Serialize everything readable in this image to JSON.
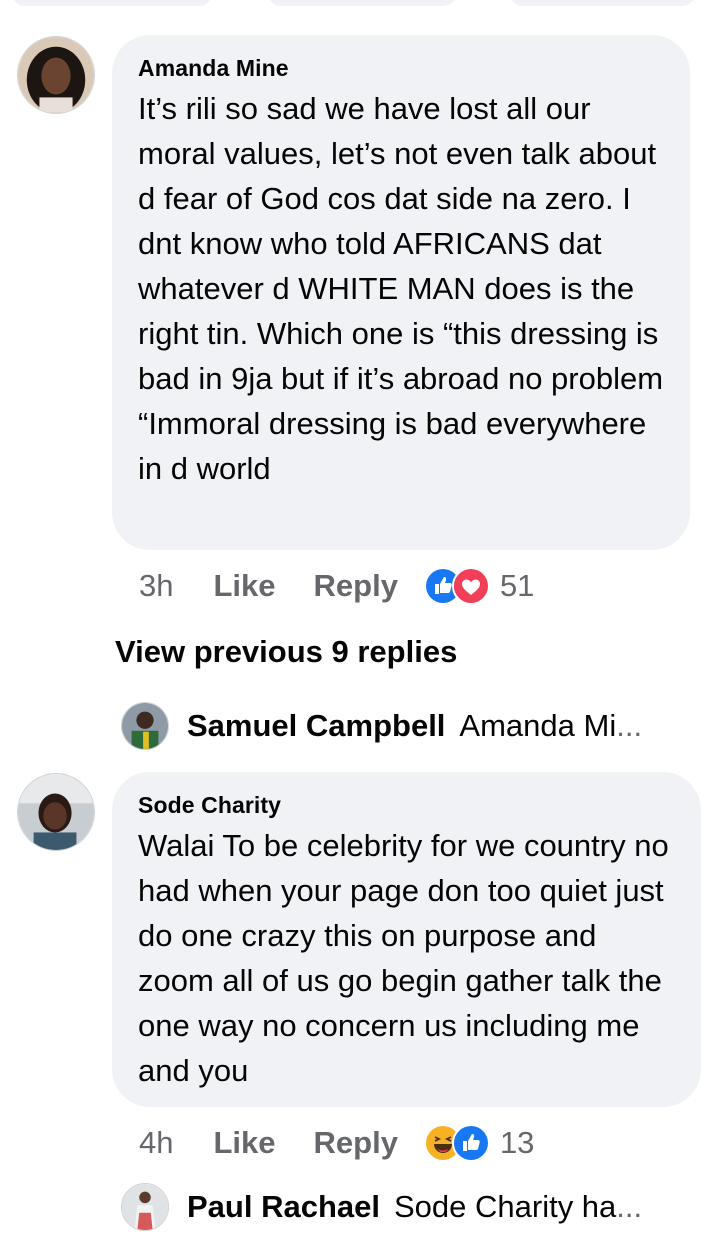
{
  "comments": [
    {
      "author": "Amanda Mine",
      "text": "It’s rili so sad we have lost all our moral values, let’s not even talk about d fear of God cos dat side na zero. I dnt know who told AFRICANS dat whatever d WHITE MAN does is the right tin. Which one is “this dressing is bad in 9ja but if it’s abroad no problem “Immoral dressing is bad everywhere in d world",
      "time": "3h",
      "like_label": "Like",
      "reply_label": "Reply",
      "reactions": [
        "like-icon",
        "love-icon"
      ],
      "reaction_count": "51"
    },
    {
      "author": "Sode Charity",
      "text": "Walai To be celebrity for we country no had when your page don too quiet just do one crazy this on purpose and zoom all of us go begin gather talk the one way no concern us including me and you",
      "time": "4h",
      "like_label": "Like",
      "reply_label": "Reply",
      "reactions": [
        "haha-icon",
        "like-icon"
      ],
      "reaction_count": "13"
    }
  ],
  "view_previous": "View previous 9 replies",
  "replies": [
    {
      "name": "Samuel Campbell",
      "snippet": "Amanda Mi",
      "ellipsis": "..."
    },
    {
      "name": "Paul Rachael",
      "snippet": "Sode Charity ha",
      "ellipsis": "..."
    }
  ],
  "colors": {
    "bubble": "#f0f2f5",
    "meta_text": "#65676b",
    "like_blue": "#1877f2",
    "love_red": "#f33e58",
    "haha_yellow": "#f7b125"
  }
}
